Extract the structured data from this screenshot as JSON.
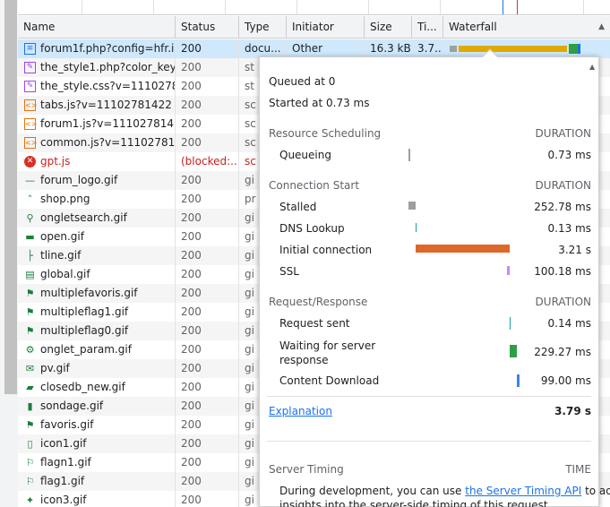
{
  "columns": {
    "name": "Name",
    "status": "Status",
    "type": "Type",
    "initiator": "Initiator",
    "size": "Size",
    "time": "Ti...",
    "waterfall": "Waterfall",
    "sort_indicator": "▲"
  },
  "rows": [
    {
      "name": "forum1f.php?config=hfr.i...",
      "status": "200",
      "type": "docu...",
      "initiator": "Other",
      "size": "16.3 kB",
      "time": "3.7...",
      "icon": "document-icon",
      "glyph": "≡",
      "kind": "doc",
      "selected": true
    },
    {
      "name": "the_style1.php?color_key...",
      "status": "200",
      "type": "st",
      "initiator": "",
      "size": "",
      "time": "",
      "icon": "stylesheet-icon",
      "glyph": "✎",
      "kind": "css"
    },
    {
      "name": "the_style.css?v=11102781...",
      "status": "200",
      "type": "st",
      "initiator": "",
      "size": "",
      "time": "",
      "icon": "stylesheet-icon",
      "glyph": "✎",
      "kind": "css"
    },
    {
      "name": "tabs.js?v=11102781422",
      "status": "200",
      "type": "sc",
      "initiator": "",
      "size": "",
      "time": "",
      "icon": "script-icon",
      "glyph": "<>",
      "kind": "js"
    },
    {
      "name": "forum1.js?v=11102781422",
      "status": "200",
      "type": "sc",
      "initiator": "",
      "size": "",
      "time": "",
      "icon": "script-icon",
      "glyph": "<>",
      "kind": "js"
    },
    {
      "name": "common.js?v=11102781...",
      "status": "200",
      "type": "sc",
      "initiator": "",
      "size": "",
      "time": "",
      "icon": "script-icon",
      "glyph": "<>",
      "kind": "js"
    },
    {
      "name": "gpt.js",
      "status": "(blocked:...",
      "type": "sc",
      "initiator": "",
      "size": "",
      "time": "",
      "icon": "error-icon",
      "glyph": "✕",
      "kind": "err"
    },
    {
      "name": "forum_logo.gif",
      "status": "200",
      "type": "gi",
      "initiator": "",
      "size": "",
      "time": "",
      "icon": "image-icon",
      "glyph": "—",
      "kind": "img"
    },
    {
      "name": "shop.png",
      "status": "200",
      "type": "pr",
      "initiator": "",
      "size": "",
      "time": "",
      "icon": "image-icon",
      "glyph": "˄",
      "kind": "img"
    },
    {
      "name": "ongletsearch.gif",
      "status": "200",
      "type": "gi",
      "initiator": "",
      "size": "",
      "time": "",
      "icon": "magnifier-icon",
      "glyph": "⚲",
      "kind": "img"
    },
    {
      "name": "open.gif",
      "status": "200",
      "type": "gi",
      "initiator": "",
      "size": "",
      "time": "",
      "icon": "folder-icon",
      "glyph": "▬",
      "kind": "img"
    },
    {
      "name": "tline.gif",
      "status": "200",
      "type": "gi",
      "initiator": "",
      "size": "",
      "time": "",
      "icon": "tree-line-icon",
      "glyph": "├",
      "kind": "img"
    },
    {
      "name": "global.gif",
      "status": "200",
      "type": "gi",
      "initiator": "",
      "size": "",
      "time": "",
      "icon": "page-icon",
      "glyph": "▤",
      "kind": "img"
    },
    {
      "name": "multiplefavoris.gif",
      "status": "200",
      "type": "gi",
      "initiator": "",
      "size": "",
      "time": "",
      "icon": "flag-icon",
      "glyph": "⚑",
      "kind": "img"
    },
    {
      "name": "multipleflag1.gif",
      "status": "200",
      "type": "gi",
      "initiator": "",
      "size": "",
      "time": "",
      "icon": "flag-icon",
      "glyph": "⚑",
      "kind": "img"
    },
    {
      "name": "multipleflag0.gif",
      "status": "200",
      "type": "gi",
      "initiator": "",
      "size": "",
      "time": "",
      "icon": "flag-icon",
      "glyph": "⚑",
      "kind": "img"
    },
    {
      "name": "onglet_param.gif",
      "status": "200",
      "type": "gi",
      "initiator": "",
      "size": "",
      "time": "",
      "icon": "settings-icon",
      "glyph": "⚙",
      "kind": "img"
    },
    {
      "name": "pv.gif",
      "status": "200",
      "type": "gi",
      "initiator": "",
      "size": "",
      "time": "",
      "icon": "envelope-icon",
      "glyph": "✉",
      "kind": "img"
    },
    {
      "name": "closedb_new.gif",
      "status": "200",
      "type": "gi",
      "initiator": "",
      "size": "",
      "time": "",
      "icon": "closed-folder-icon",
      "glyph": "▰",
      "kind": "img"
    },
    {
      "name": "sondage.gif",
      "status": "200",
      "type": "gi",
      "initiator": "",
      "size": "",
      "time": "",
      "icon": "poll-chart-icon",
      "glyph": "▮",
      "kind": "img"
    },
    {
      "name": "favoris.gif",
      "status": "200",
      "type": "gi",
      "initiator": "",
      "size": "",
      "time": "",
      "icon": "star-flag-icon",
      "glyph": "⚑",
      "kind": "img"
    },
    {
      "name": "icon1.gif",
      "status": "200",
      "type": "gi",
      "initiator": "",
      "size": "",
      "time": "",
      "icon": "page-icon",
      "glyph": "▯",
      "kind": "img"
    },
    {
      "name": "flagn1.gif",
      "status": "200",
      "type": "gi",
      "initiator": "",
      "size": "",
      "time": "",
      "icon": "flag-icon",
      "glyph": "⚐",
      "kind": "img"
    },
    {
      "name": "flag1.gif",
      "status": "200",
      "type": "gi",
      "initiator": "",
      "size": "",
      "time": "",
      "icon": "flag-icon",
      "glyph": "⚐",
      "kind": "img"
    },
    {
      "name": "icon3.gif",
      "status": "200",
      "type": "gi",
      "initiator": "",
      "size": "",
      "time": "",
      "icon": "bulb-icon",
      "glyph": "✦",
      "kind": "img"
    }
  ],
  "timing": {
    "queued_at": "Queued at 0",
    "started_at": "Started at 0.73 ms",
    "duration_header": "DURATION",
    "resource_scheduling": {
      "title": "Resource Scheduling",
      "items": [
        {
          "label": "Queueing",
          "value": "0.73 ms",
          "color": "#9e9e9e"
        }
      ]
    },
    "connection_start": {
      "title": "Connection Start",
      "items": [
        {
          "label": "Stalled",
          "value": "252.78 ms",
          "color": "#9e9e9e"
        },
        {
          "label": "DNS Lookup",
          "value": "0.13 ms",
          "color": "#1f9aa5"
        },
        {
          "label": "Initial connection",
          "value": "3.21 s",
          "color": "#e8710a"
        },
        {
          "label": "SSL",
          "value": "100.18 ms",
          "color": "#c58af9"
        }
      ]
    },
    "request_response": {
      "title": "Request/Response",
      "items": [
        {
          "label": "Request sent",
          "value": "0.14 ms",
          "color": "#1f9aa5"
        },
        {
          "label": "Waiting for server response",
          "value": "229.27 ms",
          "color": "#2ea043"
        },
        {
          "label": "Content Download",
          "value": "99.00 ms",
          "color": "#1a73e8"
        }
      ]
    },
    "explanation_link": "Explanation",
    "total": "3.79 s",
    "server_timing": {
      "title": "Server Timing",
      "time_header": "TIME",
      "text_before": "During development, you can use ",
      "link": "the Server Timing API",
      "text_after": " to add",
      "text_line2": "insights into the server-side timing of this request."
    }
  }
}
